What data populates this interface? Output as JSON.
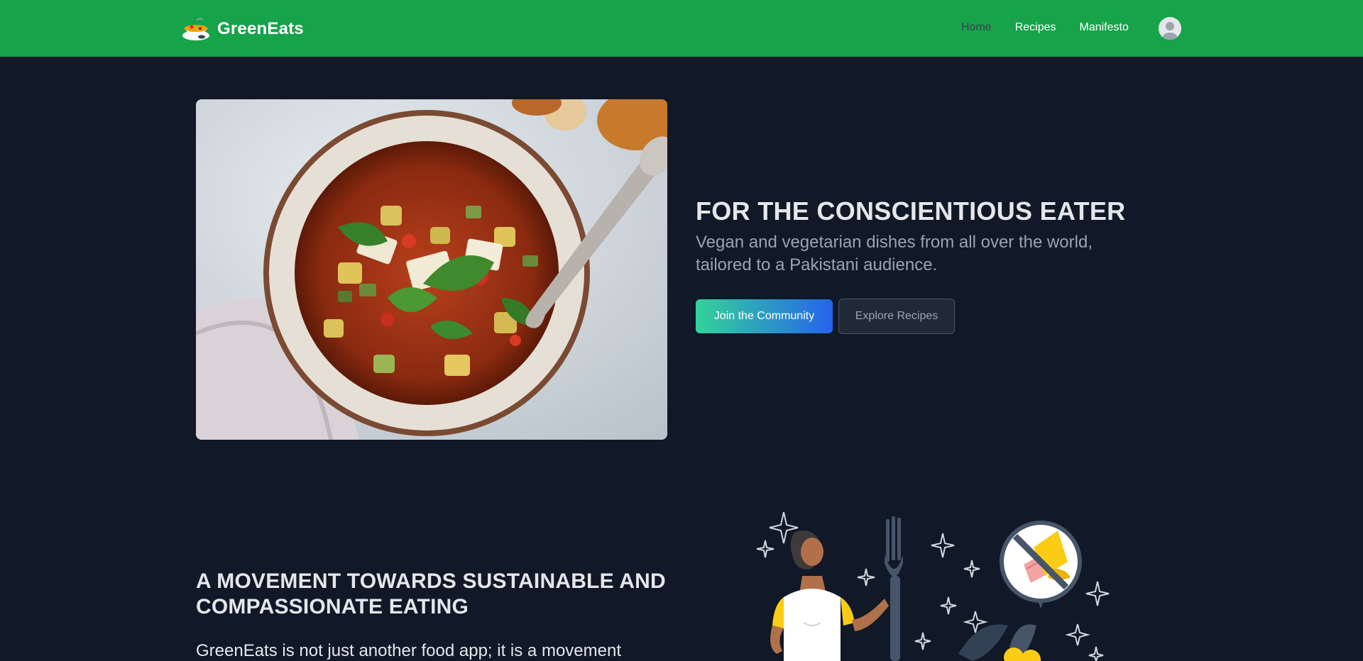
{
  "brand": {
    "name": "GreenEats",
    "logo_icon": "soup-bowl-icon"
  },
  "nav": {
    "links": [
      {
        "label": "Home",
        "active": true
      },
      {
        "label": "Recipes",
        "active": false
      },
      {
        "label": "Manifesto",
        "active": false
      }
    ],
    "avatar_icon": "user-avatar-icon"
  },
  "hero": {
    "image_icon": "minestrone-soup-photo",
    "title": "FOR THE CONSCIENTIOUS EATER",
    "subtitle": "Vegan and vegetarian dishes from all over the world, tailored to a Pakistani audience.",
    "primary_button": "Join the Community",
    "secondary_button": "Explore Recipes"
  },
  "mission": {
    "title": "A MOVEMENT TOWARDS SUSTAINABLE AND COMPASSIONATE EATING",
    "body": "GreenEats is not just another food app; it is a movement",
    "illustration_icon": "no-meat-illustration"
  },
  "colors": {
    "navbar": "#16a34a",
    "background": "#111827",
    "primary_gradient_start": "#34d399",
    "primary_gradient_end": "#2563eb"
  }
}
